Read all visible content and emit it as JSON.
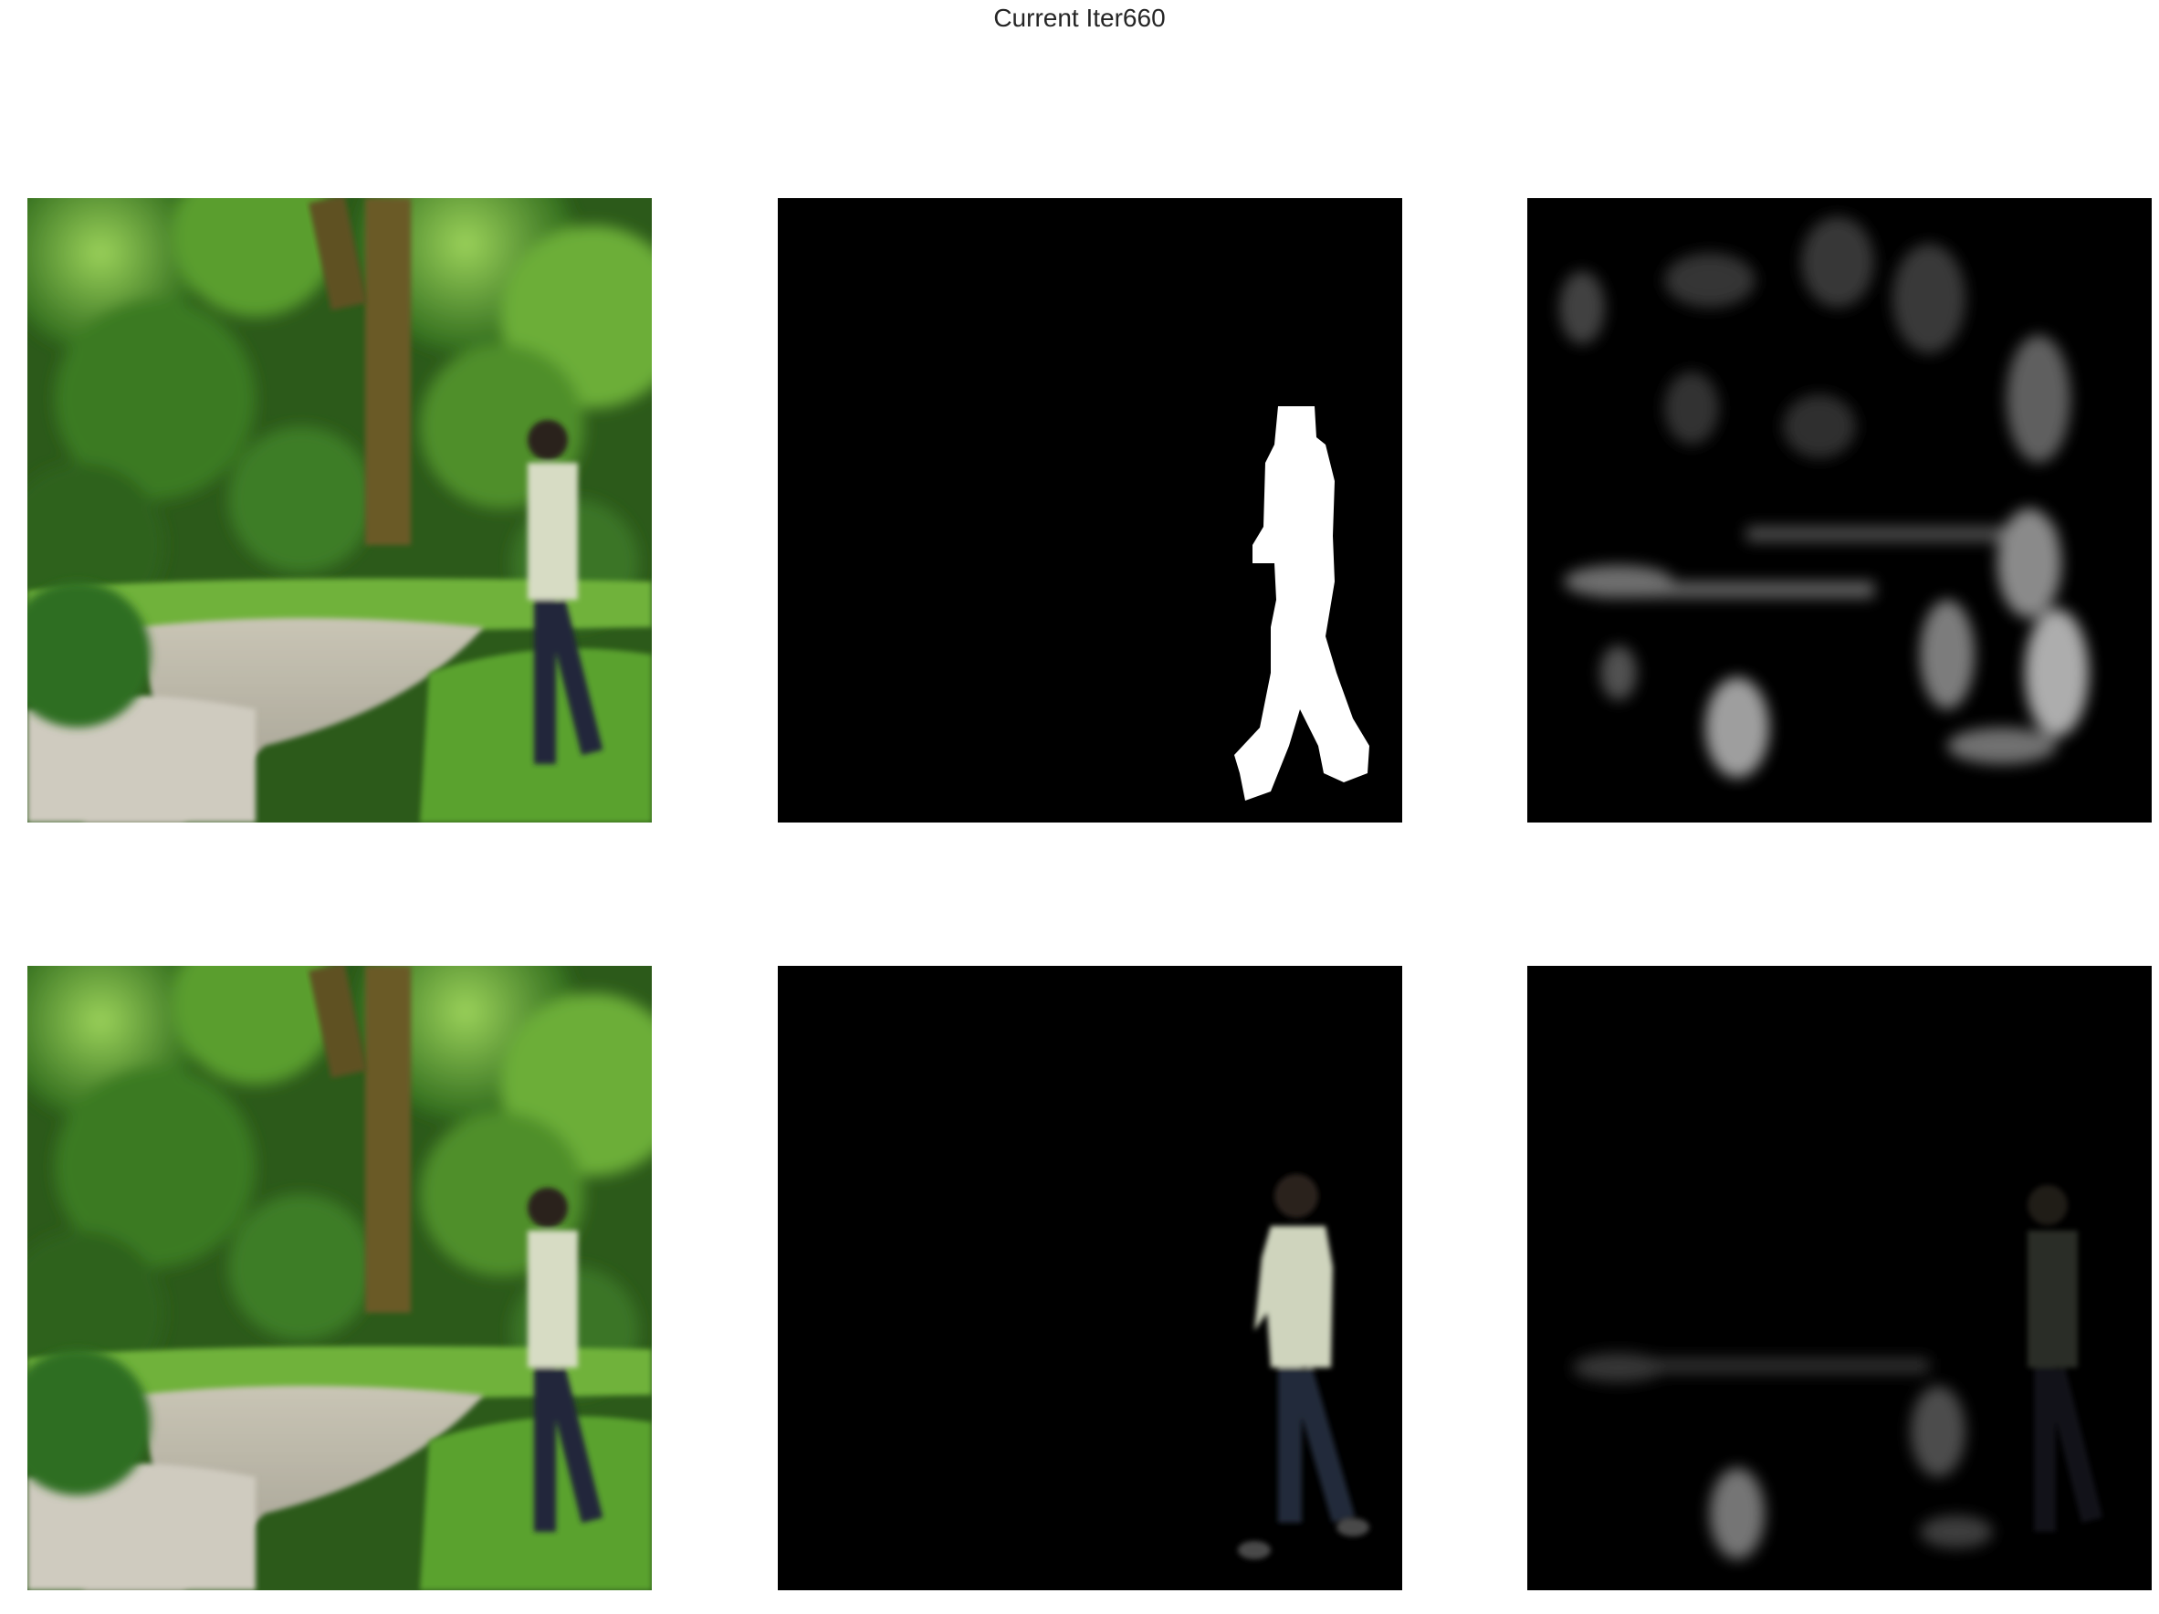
{
  "figure": {
    "title": "Current Iter660"
  },
  "panels": [
    {
      "row": 1,
      "col": 1,
      "content": "photo",
      "icon": "park-photo"
    },
    {
      "row": 1,
      "col": 2,
      "content": "mask",
      "icon": "person-mask"
    },
    {
      "row": 1,
      "col": 3,
      "content": "saliency",
      "icon": "saliency-map"
    },
    {
      "row": 2,
      "col": 1,
      "content": "photo",
      "icon": "park-photo"
    },
    {
      "row": 2,
      "col": 2,
      "content": "masked-photo",
      "icon": "masked-person"
    },
    {
      "row": 2,
      "col": 3,
      "content": "blended-saliency",
      "icon": "blended-map"
    }
  ],
  "colors": {
    "background": "#ffffff",
    "title_text": "#262626",
    "foliage": "#3f7a25",
    "mask_fg": "#ffffff",
    "mask_bg": "#000000"
  }
}
